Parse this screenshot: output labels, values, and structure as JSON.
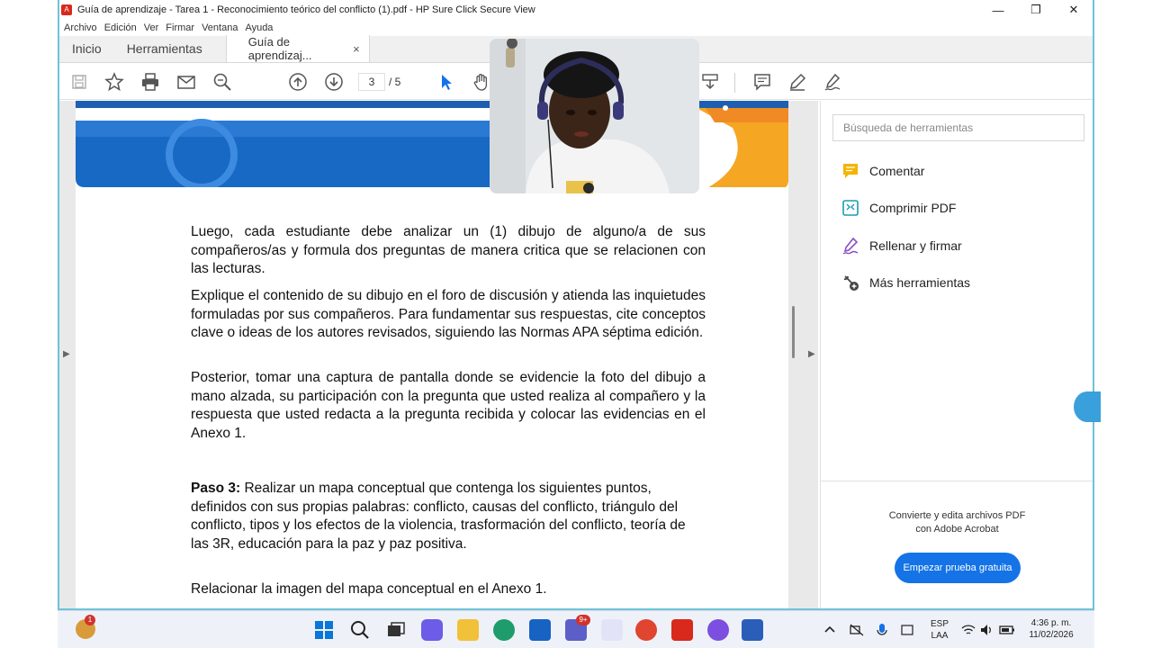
{
  "window": {
    "title": "Guía de aprendizaje - Tarea 1 - Reconocimiento teórico del conflicto (1).pdf - HP Sure Click Secure View",
    "app_icon_glyph": "A",
    "minimize": "—",
    "maximize": "❐",
    "close": "✕"
  },
  "menu": [
    "Archivo",
    "Edición",
    "Ver",
    "Firmar",
    "Ventana",
    "Ayuda"
  ],
  "tabs": {
    "home": "Inicio",
    "tools": "Herramientas",
    "document": "Guía de aprendizaj...",
    "close_glyph": "×"
  },
  "toolbar": {
    "current_page": "3",
    "total_pages": "/ 5"
  },
  "document": {
    "p1": "Luego, cada estudiante debe analizar un (1) dibujo de alguno/a de sus compañeros/as y formula dos preguntas de manera critica que se relacionen con las lecturas.",
    "p2": "Explique el contenido de su dibujo en el foro de discusión y atienda las inquietudes formuladas por sus compañeros. Para fundamentar sus respuestas, cite conceptos clave o ideas de los autores revisados, siguiendo las Normas APA séptima edición.",
    "p3": "Posterior, tomar una captura de pantalla donde se evidencie la foto del dibujo a mano alzada, su participación con la pregunta que usted realiza al compañero y la respuesta que usted redacta a la pregunta recibida y colocar las evidencias en el Anexo 1.",
    "p4_bold": "Paso 3:",
    "p4": " Realizar un mapa conceptual que contenga los siguientes puntos, definidos con sus propias palabras: conflicto, causas del conflicto, triángulo del conflicto, tipos y los efectos de la violencia, trasformación del conflicto, teoría de las 3R, educación para la paz y paz positiva.",
    "p5": "Relacionar la imagen del mapa conceptual en el Anexo 1."
  },
  "tools_panel": {
    "search_placeholder": "Búsqueda de herramientas",
    "items": [
      {
        "label": "Comentar",
        "icon": "comment-icon",
        "color": "#f4b400"
      },
      {
        "label": "Comprimir PDF",
        "icon": "compress-pdf-icon",
        "color": "#1a9bb5"
      },
      {
        "label": "Rellenar y firmar",
        "icon": "fill-sign-icon",
        "color": "#8a4fc6"
      },
      {
        "label": "Más herramientas",
        "icon": "more-tools-icon",
        "color": "#444444"
      }
    ],
    "promo_line1": "Convierte y edita archivos PDF",
    "promo_line2": "con Adobe Acrobat",
    "promo_button": "Empezar prueba gratuita"
  },
  "taskbar": {
    "notification_badge": "1",
    "teams_badge": "9+",
    "lang_line1": "ESP",
    "lang_line2": "LAA",
    "time": "4:36 p. m.",
    "date": "11/02/2026"
  },
  "colors": {
    "accent_blue": "#1473e6",
    "banner_blue": "#1769c4",
    "banner_orange": "#f5a623",
    "window_border": "#6fc3d8"
  }
}
